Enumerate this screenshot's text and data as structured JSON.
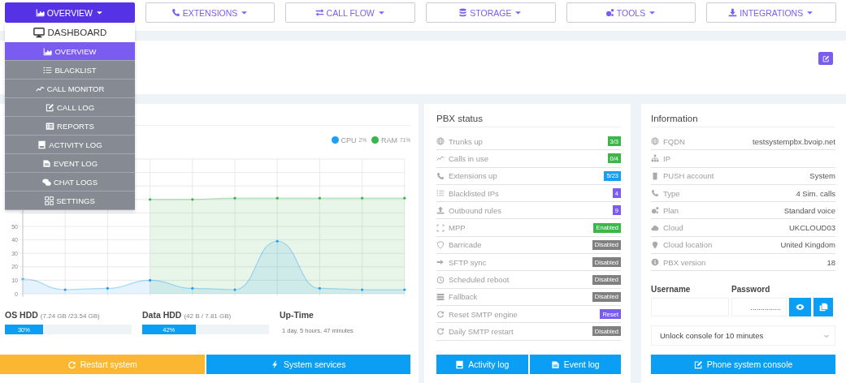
{
  "nav": [
    {
      "label": "OVERVIEW",
      "selected": true
    },
    {
      "label": "EXTENSIONS",
      "selected": false
    },
    {
      "label": "CALL FLOW",
      "selected": false
    },
    {
      "label": "STORAGE",
      "selected": false
    },
    {
      "label": "TOOLS",
      "selected": false
    },
    {
      "label": "INTEGRATIONS",
      "selected": false
    }
  ],
  "dropdown": {
    "header": "DASHBOARD",
    "items": [
      {
        "label": "OVERVIEW",
        "selected": true
      },
      {
        "label": "BLACKLIST",
        "selected": false
      },
      {
        "label": "CALL MONITOR",
        "selected": false
      },
      {
        "label": "CALL LOG",
        "selected": false
      },
      {
        "label": "REPORTS",
        "selected": false
      },
      {
        "label": "ACTIVITY LOG",
        "selected": false
      },
      {
        "label": "EVENT LOG",
        "selected": false
      },
      {
        "label": "CHAT LOGS",
        "selected": false
      },
      {
        "label": "SETTINGS",
        "selected": false
      }
    ]
  },
  "resources_card": {
    "legend_readings": [
      "2%",
      "71%"
    ],
    "chart_data": {
      "type": "area",
      "grid": true,
      "ylim": [
        0,
        100
      ],
      "yticks": [
        0,
        10,
        20,
        30,
        40,
        50
      ],
      "series": [
        {
          "name": "CPU",
          "color": "#1e9ff2",
          "values": [
            11,
            3,
            4,
            10,
            4,
            3,
            39,
            4,
            3,
            3
          ]
        },
        {
          "name": "RAM",
          "color": "#39b54a",
          "values": [
            null,
            null,
            null,
            70,
            70,
            71,
            71,
            71,
            71,
            71
          ]
        }
      ]
    },
    "disks": [
      {
        "title": "OS HDD",
        "detail": "(7.24 GB /23.54 GB)",
        "level": 0.3,
        "reading": "30%"
      },
      {
        "title": "Data HDD",
        "detail": "(42 B / 7.81 GB)",
        "level": 0.42,
        "reading": "42%"
      }
    ],
    "uptime": {
      "title": "Up-Time",
      "value": "1 day, 5 hours, 47 minutes"
    },
    "buttons": [
      {
        "label": "Restart system",
        "kind": "warning"
      },
      {
        "label": "System services",
        "kind": "primary"
      }
    ]
  },
  "pbx_status": {
    "title": "PBX status",
    "rows": [
      {
        "label": "Trunks up",
        "badge": "3/3",
        "color": "#3cb54a"
      },
      {
        "label": "Calls in use",
        "badge": "0/4",
        "color": "#3cb54a"
      },
      {
        "label": "Extensions up",
        "badge": "5/23",
        "color": "#169ff0"
      },
      {
        "label": "Blacklisted IPs",
        "badge": "4",
        "color": "#7b5cf0"
      },
      {
        "label": "Outbound rules",
        "badge": "9",
        "color": "#7b5cf0"
      },
      {
        "label": "MPP",
        "badge": "Enabled",
        "color": "#3cb54a"
      },
      {
        "label": "Barricade",
        "badge": "Disabled",
        "color": "#808080"
      },
      {
        "label": "SFTP sync",
        "badge": "Disabled",
        "color": "#808080"
      },
      {
        "label": "Scheduled reboot",
        "badge": "Disabled",
        "color": "#808080"
      },
      {
        "label": "Fallback",
        "badge": "Disabled",
        "color": "#808080"
      },
      {
        "label": "Reset SMTP engine",
        "badge": "Reset",
        "color": "#7b5cf0"
      },
      {
        "label": "Daily SMTP restart",
        "badge": "Disabled",
        "color": "#808080"
      }
    ],
    "buttons": [
      "Activity log",
      "Event log"
    ]
  },
  "information": {
    "title": "Information",
    "rows": [
      {
        "label": "FQDN",
        "value": "testsystempbx.bvoip.net"
      },
      {
        "label": "IP"
      },
      {
        "label": "PUSH account",
        "value": "System"
      },
      {
        "label": "Type",
        "value": "4 Sim. calls"
      },
      {
        "label": "Plan",
        "value": "Standard voice"
      },
      {
        "label": "Cloud",
        "value": "UKCLOUD03"
      },
      {
        "label": "Cloud location",
        "value": "United Kingdom"
      },
      {
        "label": "PBX version",
        "value": "18"
      }
    ],
    "username": {
      "label": "Username"
    },
    "password": {
      "label": "Password",
      "value": "..............."
    },
    "unlock_select": {
      "value": "Unlock console for 10 minutes"
    },
    "console_button": "Phone system console"
  }
}
